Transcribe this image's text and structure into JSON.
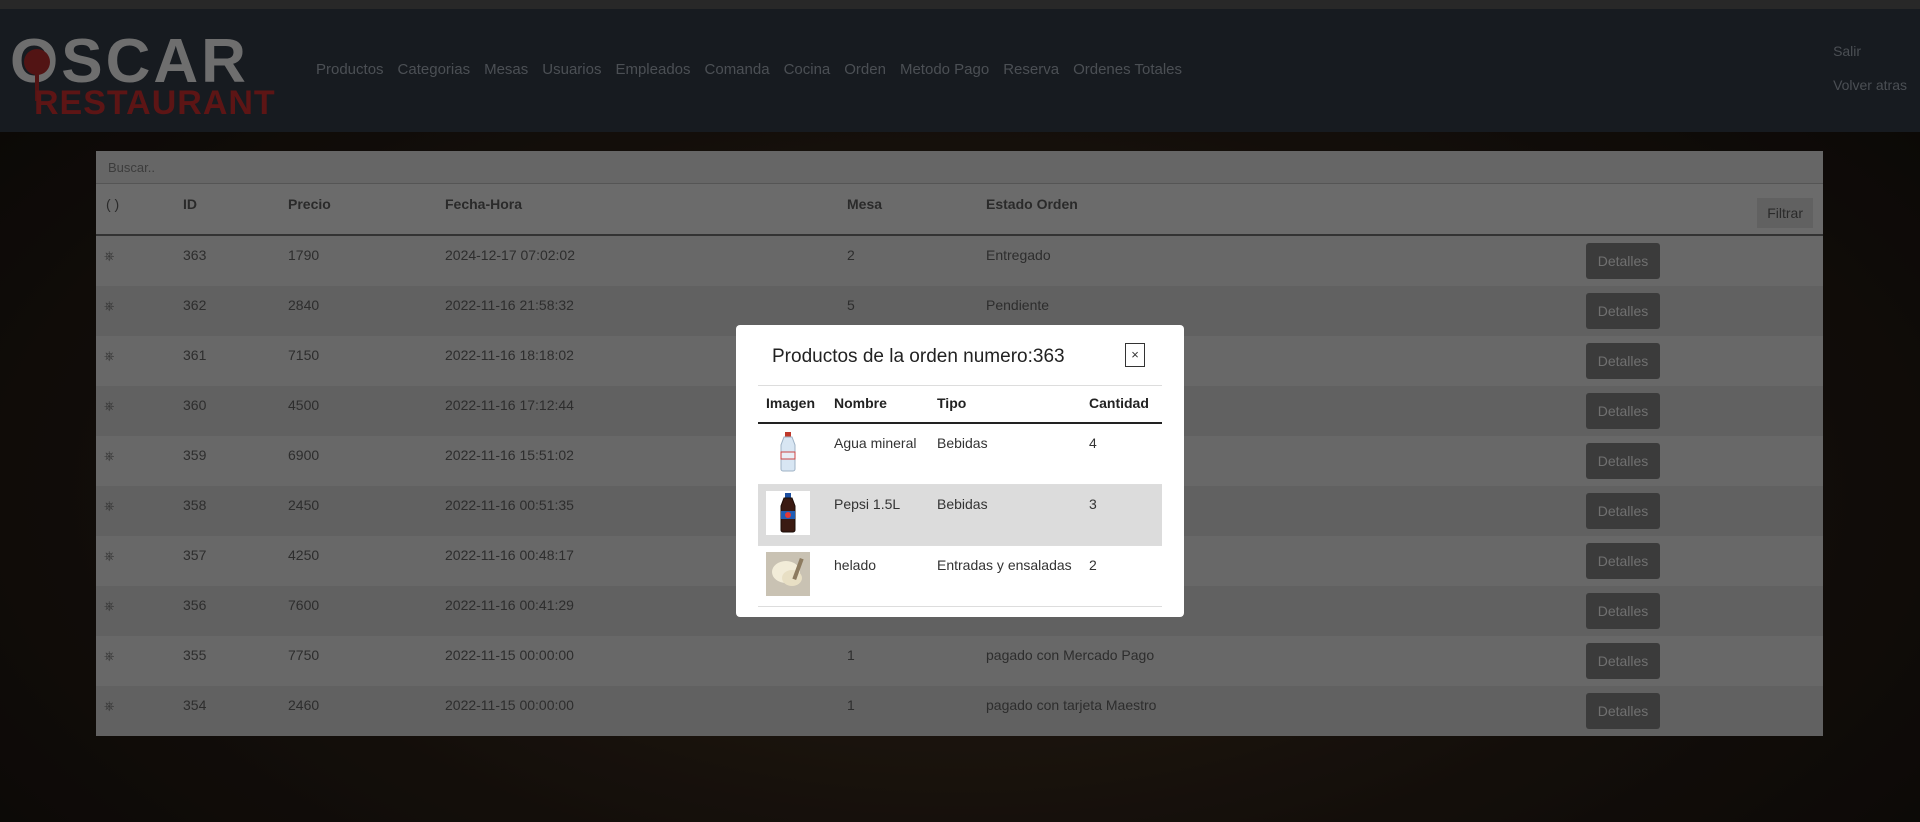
{
  "brand": {
    "line1": "OSCAR",
    "line2": "RESTAURANT"
  },
  "nav": [
    "Productos",
    "Categorias",
    "Mesas",
    "Usuarios",
    "Empleados",
    "Comanda",
    "Cocina",
    "Orden",
    "Metodo Pago",
    "Reserva",
    "Ordenes Totales"
  ],
  "right_links": [
    "Salir",
    "Volver atras"
  ],
  "search": {
    "placeholder": "Buscar.."
  },
  "table": {
    "headers": [
      "ID",
      "Precio",
      "Fecha-Hora",
      "Mesa",
      "Estado Orden"
    ],
    "sort_icon": "( )",
    "filter_label": "Filtrar",
    "details_label": "Detalles",
    "rows": [
      {
        "id": "363",
        "precio": "1790",
        "fecha": "2024-12-17 07:02:02",
        "mesa": "2",
        "estado": "Entregado"
      },
      {
        "id": "362",
        "precio": "2840",
        "fecha": "2022-11-16 21:58:32",
        "mesa": "5",
        "estado": "Pendiente"
      },
      {
        "id": "361",
        "precio": "7150",
        "fecha": "2022-11-16 18:18:02",
        "mesa": "",
        "estado": ""
      },
      {
        "id": "360",
        "precio": "4500",
        "fecha": "2022-11-16 17:12:44",
        "mesa": "",
        "estado": ""
      },
      {
        "id": "359",
        "precio": "6900",
        "fecha": "2022-11-16 15:51:02",
        "mesa": "",
        "estado": ""
      },
      {
        "id": "358",
        "precio": "2450",
        "fecha": "2022-11-16 00:51:35",
        "mesa": "",
        "estado": ""
      },
      {
        "id": "357",
        "precio": "4250",
        "fecha": "2022-11-16 00:48:17",
        "mesa": "",
        "estado": ""
      },
      {
        "id": "356",
        "precio": "7600",
        "fecha": "2022-11-16 00:41:29",
        "mesa": "",
        "estado": ""
      },
      {
        "id": "355",
        "precio": "7750",
        "fecha": "2022-11-15 00:00:00",
        "mesa": "1",
        "estado": "pagado con Mercado Pago"
      },
      {
        "id": "354",
        "precio": "2460",
        "fecha": "2022-11-15 00:00:00",
        "mesa": "1",
        "estado": "pagado con tarjeta Maestro"
      }
    ]
  },
  "modal": {
    "title": "Productos de la orden numero:363",
    "close": "×",
    "headers": [
      "Imagen",
      "Nombre",
      "Tipo",
      "Cantidad"
    ],
    "items": [
      {
        "nombre": "Agua mineral",
        "tipo": "Bebidas",
        "cantidad": "4",
        "image": "water-bottle"
      },
      {
        "nombre": "Pepsi 1.5L",
        "tipo": "Bebidas",
        "cantidad": "3",
        "image": "pepsi-bottle"
      },
      {
        "nombre": "helado",
        "tipo": "Entradas y ensaladas",
        "cantidad": "2",
        "image": "ice-cream"
      }
    ]
  }
}
